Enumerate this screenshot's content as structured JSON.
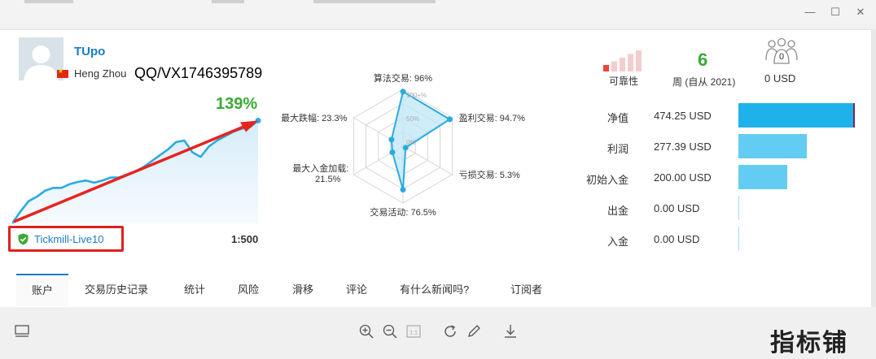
{
  "window": {
    "close_glyph": "✕",
    "maximize_glyph": "☐",
    "minimize_glyph": "—"
  },
  "profile": {
    "username": "TUpo",
    "city": "Heng Zhou",
    "overlay_text": "QQ/VX1746395789",
    "flag_color": "#de2910"
  },
  "growth": {
    "gain": "139%",
    "account": "Tickmill-Live10",
    "leverage": "1:500",
    "line_color": "#29abe2",
    "arrow_color": "#e8231e",
    "chart_data": {
      "type": "area",
      "x": [
        0,
        1,
        2,
        3,
        4,
        5,
        6,
        7,
        8,
        9,
        10,
        11,
        12,
        13,
        14,
        15,
        16,
        17,
        18,
        19,
        20,
        21,
        22,
        23,
        24,
        25,
        26,
        27,
        28,
        29,
        30
      ],
      "values": [
        0,
        16,
        30,
        36,
        44,
        48,
        48,
        53,
        56,
        58,
        55,
        58,
        62,
        62,
        66,
        70,
        76,
        84,
        92,
        100,
        110,
        112,
        96,
        90,
        104,
        112,
        118,
        124,
        128,
        130,
        139
      ],
      "ylim": [
        0,
        145
      ]
    }
  },
  "radar": {
    "chart_data": {
      "type": "radar",
      "axes": [
        {
          "label": "算法交易: 96%",
          "value": 96
        },
        {
          "label": "盈利交易: 94.7%",
          "value": 94.7
        },
        {
          "label": "亏损交易: 5.3%",
          "value": 5.3
        },
        {
          "label": "交易活动: 76.5%",
          "value": 76.5
        },
        {
          "label": "最大入金加载:",
          "label2": "21.5%",
          "value": 21.5
        },
        {
          "label": "最大跌幅: 23.3%",
          "value": 23.3
        }
      ],
      "rings": [
        "100+%",
        "50%",
        "0%"
      ],
      "range": [
        0,
        100
      ]
    }
  },
  "stats": {
    "reliability_label": "可靠性",
    "reliability_level": 1,
    "reliability_max": 5,
    "weeks": "6",
    "weeks_label": "周 (自从 2021)",
    "subscribers": "0",
    "subscriber_funds": "0 USD"
  },
  "financials": {
    "chart_data": {
      "type": "bar",
      "categories": [
        "净值",
        "利润",
        "初始入金",
        "出金",
        "入金"
      ],
      "values": [
        474.25,
        277.39,
        200.0,
        0.0,
        0.0
      ],
      "xlim": [
        0,
        474.25
      ]
    },
    "rows": [
      {
        "label": "净值",
        "value": "474.25 USD"
      },
      {
        "label": "利润",
        "value": "277.39 USD"
      },
      {
        "label": "初始入金",
        "value": "200.00 USD"
      },
      {
        "label": "出金",
        "value": "0.00 USD"
      },
      {
        "label": "入金",
        "value": "0.00 USD"
      }
    ]
  },
  "tabs": [
    {
      "label": "账户"
    },
    {
      "label": "交易历史记录"
    },
    {
      "label": "统计"
    },
    {
      "label": "风险"
    },
    {
      "label": "滑移"
    },
    {
      "label": "评论"
    },
    {
      "label": "有什么新闻吗?"
    },
    {
      "label": "订阅者"
    }
  ],
  "toolbar": {
    "page_number": "1:1"
  },
  "watermark": "指标铺"
}
